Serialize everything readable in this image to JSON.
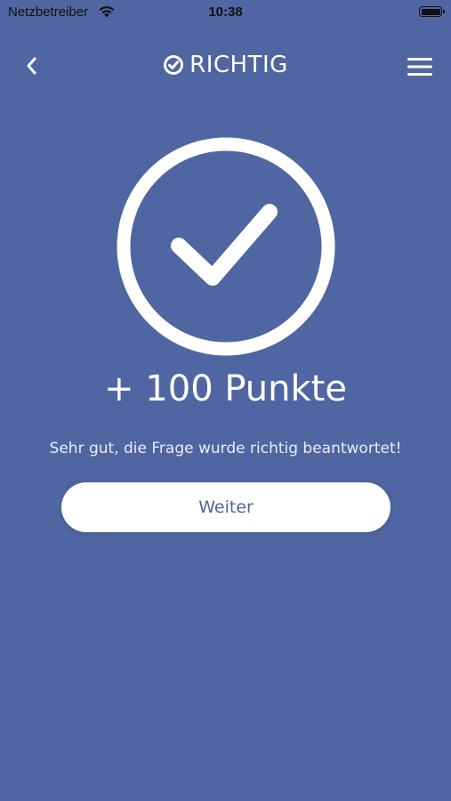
{
  "status_bar": {
    "carrier": "Netzbetreiber",
    "time": "10:38"
  },
  "header": {
    "title": "RICHTIG",
    "back_icon": "chevron-left-icon",
    "title_icon": "check-circle-icon",
    "menu_icon": "hamburger-menu-icon"
  },
  "result": {
    "icon": "check-circle-large-icon",
    "points": "+ 100 Punkte",
    "message": "Sehr gut, die Frage wurde richtig beantwortet!",
    "button_label": "Weiter"
  },
  "colors": {
    "background": "#5066a3",
    "foreground": "#ffffff",
    "button_text": "#50659f"
  }
}
